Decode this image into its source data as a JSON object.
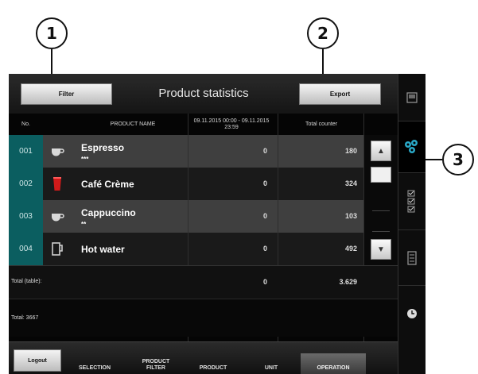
{
  "callouts": [
    "1",
    "2",
    "3"
  ],
  "screen": {
    "title": "Product statistics",
    "filter_label": "Filter",
    "export_label": "Export"
  },
  "columns": {
    "no": "No.",
    "name": "PRODUCT NAME",
    "period": "09.11.2015 00:00 - 09.11.2015 23:59",
    "total": "Total counter"
  },
  "rows": [
    {
      "no": "001",
      "name": "Espresso",
      "strength": "***",
      "icon": "cup-icon",
      "period": "0",
      "total": "180"
    },
    {
      "no": "002",
      "name": "Café Crème",
      "strength": "",
      "icon": "red-cup-icon",
      "period": "0",
      "total": "324"
    },
    {
      "no": "003",
      "name": "Cappuccino",
      "strength": "**",
      "icon": "cup-icon",
      "period": "0",
      "total": "103"
    },
    {
      "no": "004",
      "name": "Hot water",
      "strength": "",
      "icon": "mug-icon",
      "period": "0",
      "total": "492"
    }
  ],
  "totals": {
    "table_label": "Total (table):",
    "period_total": "0",
    "counter_total": "3.629",
    "overall_label": "Total: 3667"
  },
  "bottom_tabs": {
    "logout": "Logout",
    "selection": "SELECTION",
    "product_filter": "PRODUCT FILTER",
    "product": "PRODUCT",
    "unit": "UNIT",
    "operation": "OPERATION"
  },
  "right_sidebar": {
    "items": [
      "screen-icon",
      "statistics-icon",
      "checklist-icon",
      "document-icon",
      "clock-icon"
    ],
    "active": "statistics-icon"
  },
  "colors": {
    "row_number_teal": "#0b5e60",
    "row_odd": "#3f3f3f",
    "row_even": "#1a1a1a",
    "statistics_accent": "#2aa9c8"
  }
}
